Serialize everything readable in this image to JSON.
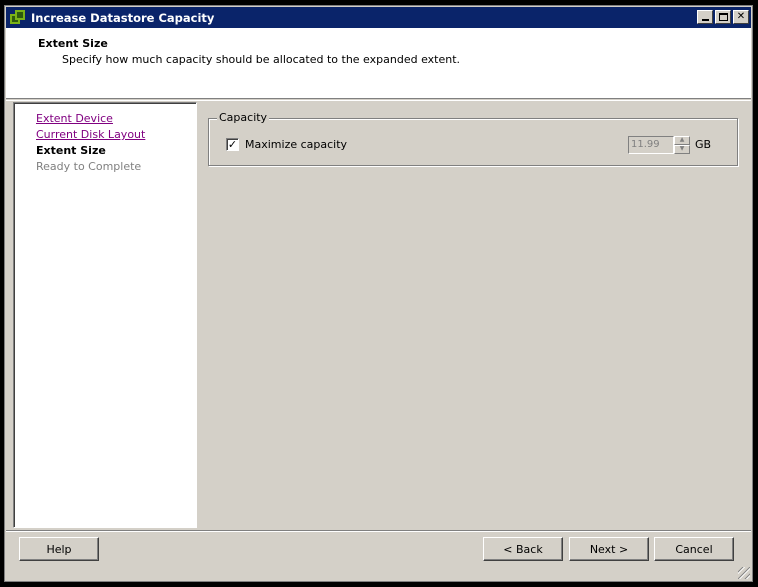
{
  "window": {
    "title": "Increase Datastore Capacity",
    "icon": "vsphere-datastore-icon",
    "controls": [
      "minimize",
      "maximize",
      "close"
    ]
  },
  "header": {
    "title": "Extent Size",
    "subtitle": "Specify how much capacity should be allocated to the expanded extent."
  },
  "nav": {
    "items": [
      {
        "label": "Extent Device",
        "state": "visited"
      },
      {
        "label": "Current Disk Layout",
        "state": "visited"
      },
      {
        "label": "Extent Size",
        "state": "current"
      },
      {
        "label": "Ready to Complete",
        "state": "disabled"
      }
    ]
  },
  "capacity": {
    "group_label": "Capacity",
    "maximize_label": "Maximize capacity",
    "maximize_checked": true,
    "value": "11.99",
    "unit": "GB"
  },
  "buttons": {
    "help": "Help",
    "back": "< Back",
    "next": "Next >",
    "cancel": "Cancel"
  },
  "colors": {
    "titlebar": "#0a246a",
    "face": "#d4d0c8",
    "visited_link": "#800080"
  }
}
